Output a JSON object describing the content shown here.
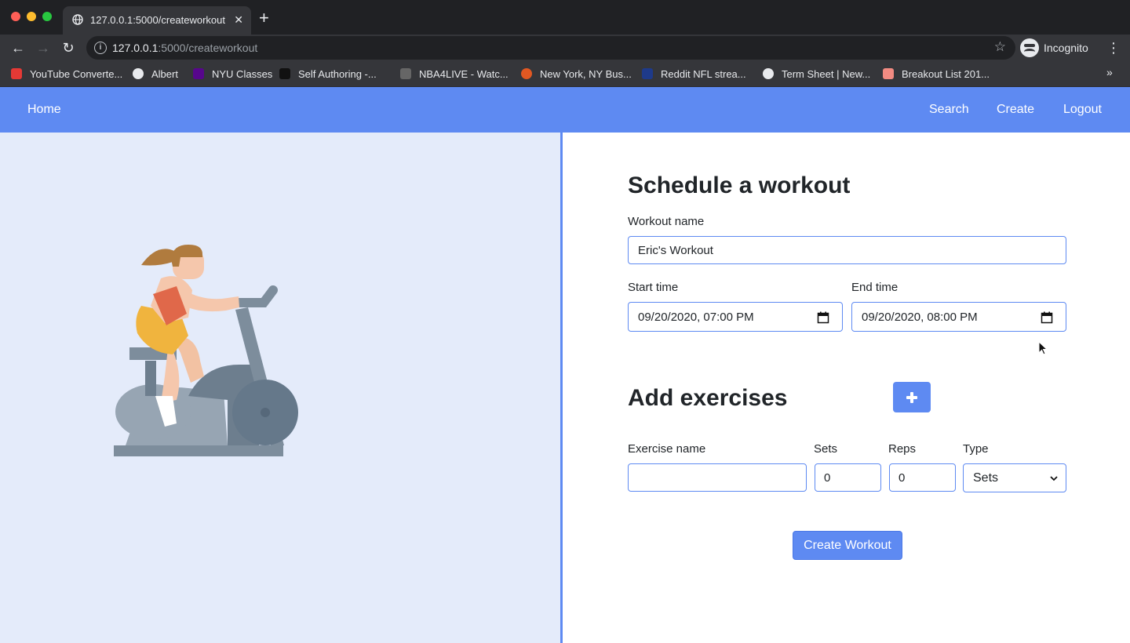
{
  "browser": {
    "tab_title": "127.0.0.1:5000/createworkout",
    "tab_close": "✕",
    "new_tab": "+",
    "url_host": "127.0.0.1",
    "url_path": ":5000/createworkout",
    "profile_label": "Incognito",
    "bookmarks": [
      {
        "label": "YouTube Converte...",
        "color": "#e53935"
      },
      {
        "label": "Albert",
        "color": "#e8eaed"
      },
      {
        "label": "NYU Classes",
        "color": "#57068c"
      },
      {
        "label": "Self Authoring -...",
        "color": "#111111"
      },
      {
        "label": "NBA4LIVE - Watc...",
        "color": "#666666"
      },
      {
        "label": "New York, NY Bus...",
        "color": "#e25822"
      },
      {
        "label": "Reddit NFL strea...",
        "color": "#1e3a8a"
      },
      {
        "label": "Term Sheet | New...",
        "color": "#e8eaed"
      },
      {
        "label": "Breakout List 201...",
        "color": "#f28b82"
      }
    ],
    "bookmarks_more": "»"
  },
  "navbar": {
    "home": "Home",
    "search": "Search",
    "create": "Create",
    "logout": "Logout"
  },
  "form": {
    "title": "Schedule a workout",
    "workout_name_label": "Workout name",
    "workout_name_value": "Eric's Workout",
    "start_time_label": "Start time",
    "start_time_value": "09/20/2020, 07:00 PM",
    "end_time_label": "End time",
    "end_time_value": "09/20/2020, 08:00 PM",
    "exercises_title": "Add exercises",
    "exercise_name_label": "Exercise name",
    "exercise_name_value": "",
    "sets_label": "Sets",
    "sets_value": "0",
    "reps_label": "Reps",
    "reps_value": "0",
    "type_label": "Type",
    "type_value": "Sets",
    "submit_label": "Create Workout"
  },
  "colors": {
    "accent": "#5e8af2",
    "left_pane_bg": "#e4ebfa"
  }
}
